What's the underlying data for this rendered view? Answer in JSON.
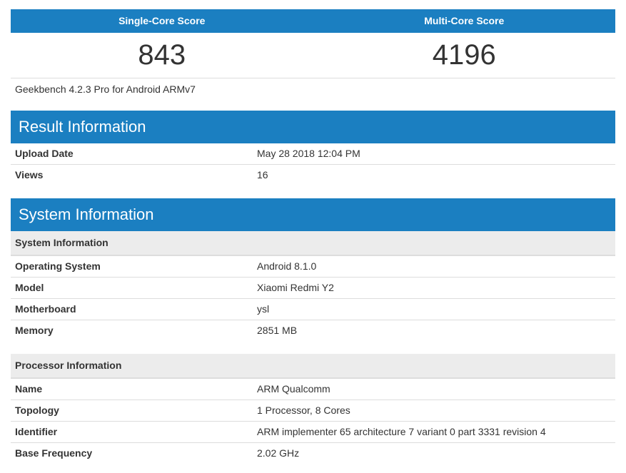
{
  "scores": {
    "single_label": "Single-Core Score",
    "multi_label": "Multi-Core Score",
    "single_value": "843",
    "multi_value": "4196",
    "version": "Geekbench 4.2.3 Pro for Android ARMv7"
  },
  "result": {
    "title": "Result Information",
    "rows": [
      {
        "key": "Upload Date",
        "value": "May 28 2018 12:04 PM"
      },
      {
        "key": "Views",
        "value": "16"
      }
    ]
  },
  "system": {
    "title": "System Information",
    "sub1": "System Information",
    "rows1": [
      {
        "key": "Operating System",
        "value": "Android 8.1.0"
      },
      {
        "key": "Model",
        "value": "Xiaomi Redmi Y2"
      },
      {
        "key": "Motherboard",
        "value": "ysl"
      },
      {
        "key": "Memory",
        "value": "2851 MB"
      }
    ],
    "sub2": "Processor Information",
    "rows2": [
      {
        "key": "Name",
        "value": "ARM Qualcomm"
      },
      {
        "key": "Topology",
        "value": "1 Processor, 8 Cores"
      },
      {
        "key": "Identifier",
        "value": "ARM implementer 65 architecture 7 variant 0 part 3331 revision 4"
      },
      {
        "key": "Base Frequency",
        "value": "2.02 GHz"
      }
    ]
  },
  "colors": {
    "accent": "#1b7fc1",
    "subhead_bg": "#ececec"
  }
}
